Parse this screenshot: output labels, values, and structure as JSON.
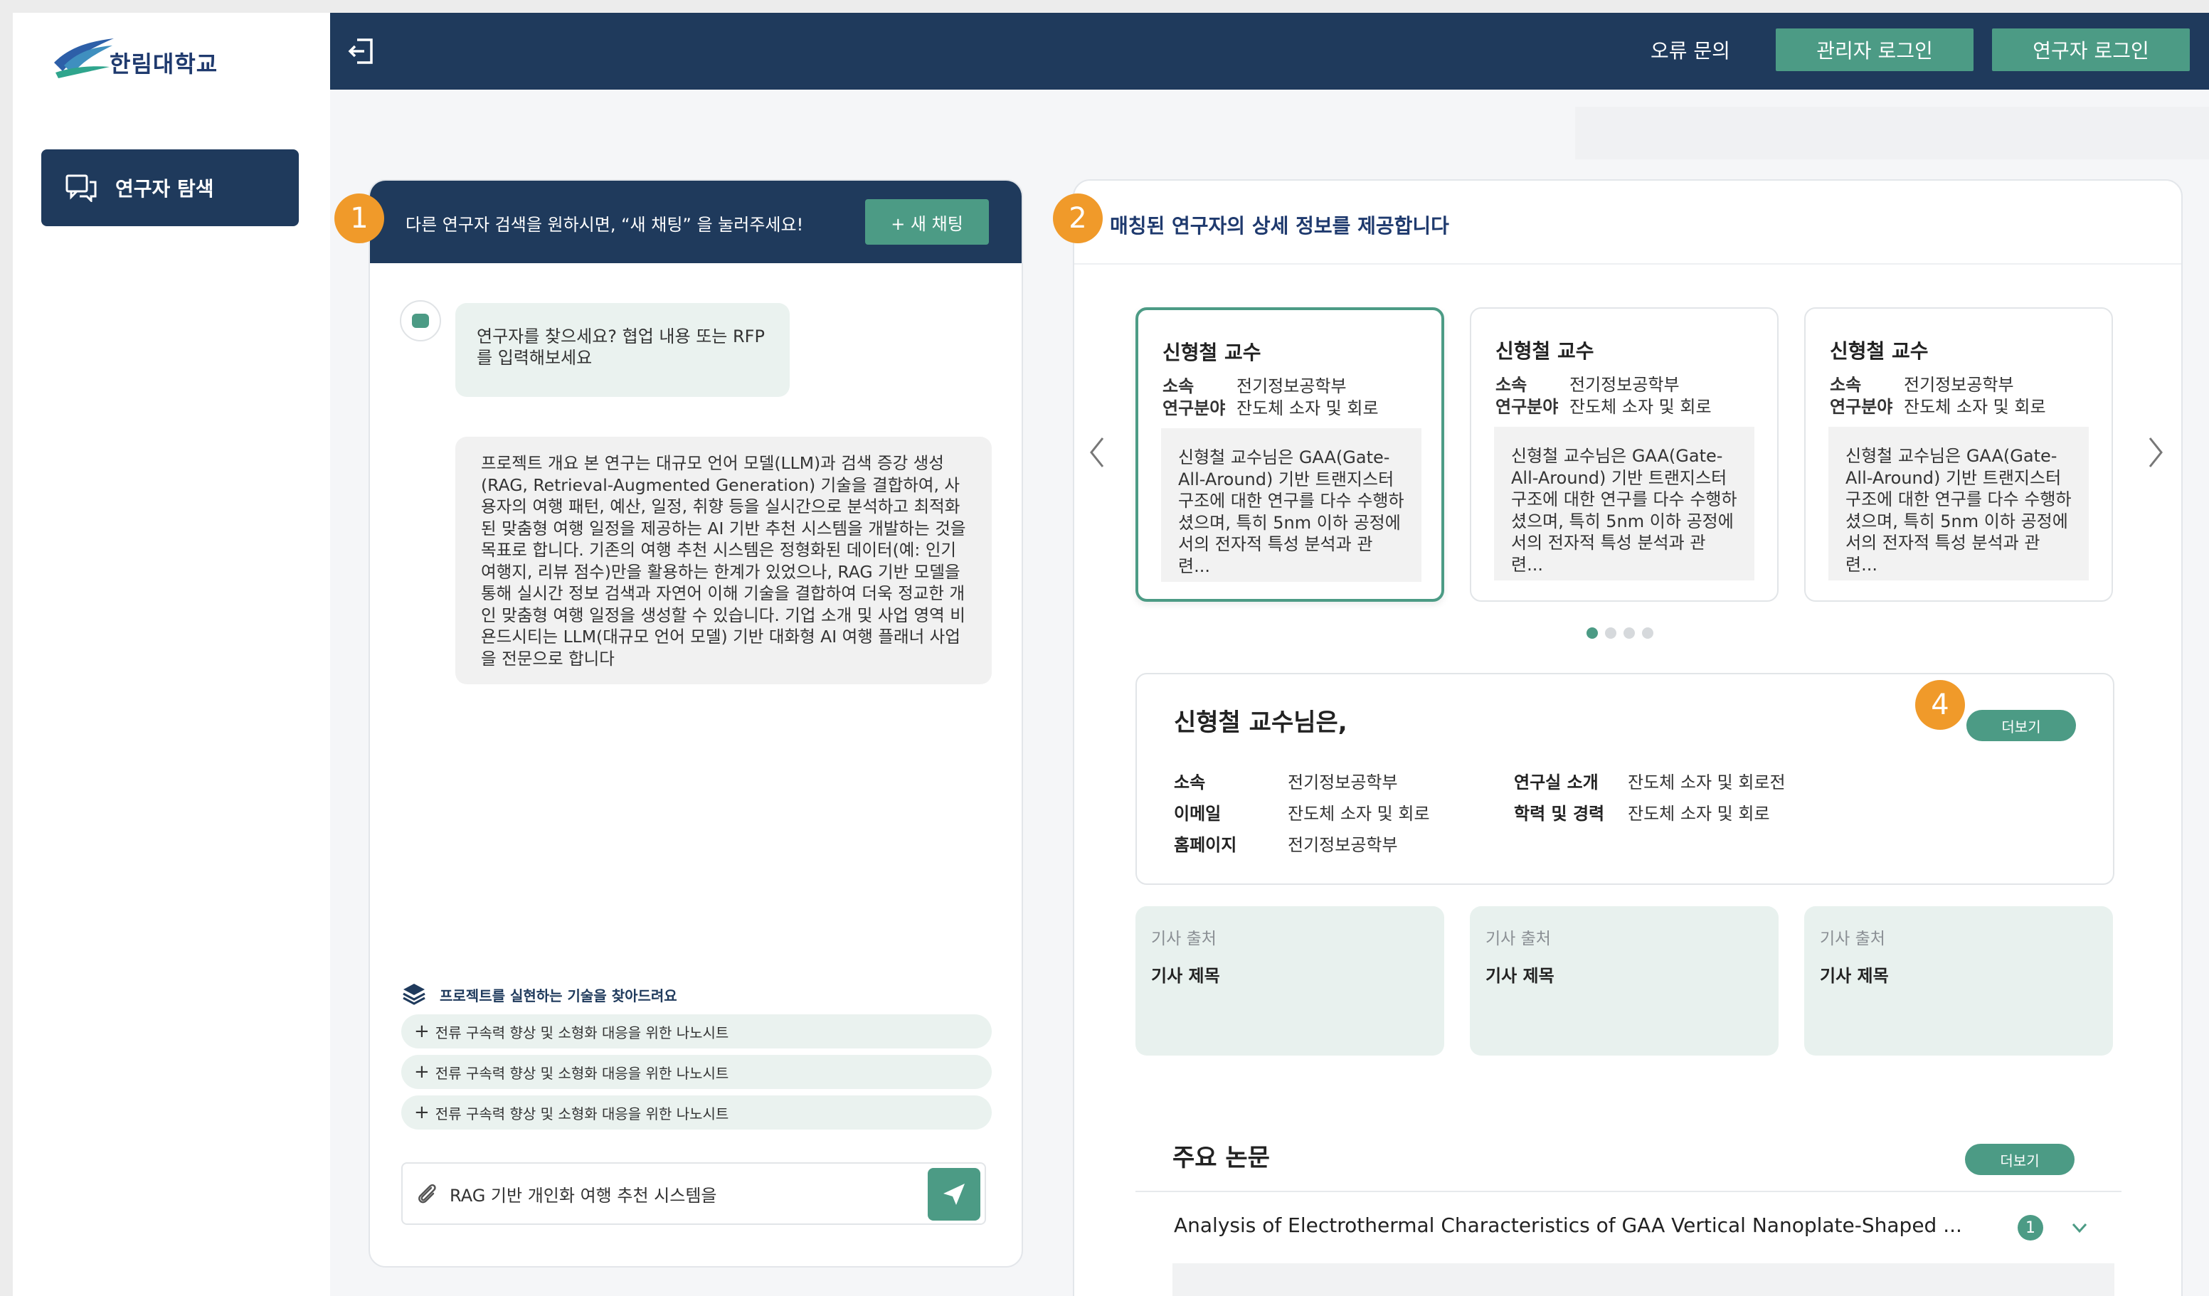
{
  "brand": {
    "name": "한림대학교"
  },
  "sidebar": {
    "items": [
      {
        "label": "연구자 탐색",
        "icon": "chat-icon"
      }
    ]
  },
  "header": {
    "error_link": "오류 문의",
    "admin_login": "관리자 로그인",
    "researcher_login": "연구자 로그인",
    "colors": {
      "navy": "#1f3a5c",
      "green": "#4c9b85",
      "badge": "#f09a2a"
    }
  },
  "chat": {
    "header_message": "다른 연구자 검색을 원하시면, “새 채팅” 을 눌러주세요!",
    "new_chat_label": "+ 새 채팅",
    "bot_message": "연구자를 찾으세요? 협업 내용 또는 RFP를 입력해보세요",
    "user_message": "프로젝트 개요 본 연구는 대규모 언어 모델(LLM)과 검색 증강 생성(RAG, Retrieval-Augmented Generation) 기술을 결합하여, 사용자의 여행 패턴, 예산, 일정, 취향 등을 실시간으로 분석하고 최적화된 맞춤형 여행 일정을 제공하는 AI 기반 추천 시스템을 개발하는 것을 목표로 합니다. 기존의 여행 추천 시스템은 정형화된 데이터(예: 인기 여행지, 리뷰 점수)만을 활용하는 한계가 있었으나, RAG 기반 모델을 통해 실시간 정보 검색과 자연어 이해 기술을 결합하여 더욱 정교한 개인 맞춤형 여행 일정을 생성할 수 있습니다. 기업 소개 및 사업 영역 비욘드시티는 LLM(대규모 언어 모델) 기반 대화형 AI 여행 플래너 사업을 전문으로 합니다",
    "tech_title": "프로젝트를 실현하는 기술을 찾아드려요",
    "tech_items": [
      "전류 구속력 향상 및 소형화 대응을 위한 나노시트",
      "전류 구속력 향상 및 소형화 대응을 위한 나노시트",
      "전류 구속력 향상 및 소형화 대응을 위한 나노시트"
    ],
    "input_value": "RAG 기반 개인화 여행 추천 시스템을",
    "badge": "1"
  },
  "detail": {
    "title": "매칭된 연구자의 상세 정보를 제공합니다",
    "badge": "2",
    "cards": [
      {
        "name": "신형철 교수",
        "affil_label": "소속",
        "affil": "전기정보공학부",
        "field_label": "연구분야",
        "field": "잔도체 소자 및 회로",
        "abstract": "신형철 교수님은 GAA(Gate-All-Around) 기반 트랜지스터 구조에 대한 연구를 다수 수행하셨으며, 특히 5nm 이하 공정에서의 전자적 특성 분석과 관련..."
      },
      {
        "name": "신형철 교수",
        "affil_label": "소속",
        "affil": "전기정보공학부",
        "field_label": "연구분야",
        "field": "잔도체 소자 및 회로",
        "abstract": "신형철 교수님은 GAA(Gate-All-Around) 기반 트랜지스터 구조에 대한 연구를 다수 수행하셨으며, 특히 5nm 이하 공정에서의 전자적 특성 분석과 관련..."
      },
      {
        "name": "신형철 교수",
        "affil_label": "소속",
        "affil": "전기정보공학부",
        "field_label": "연구분야",
        "field": "잔도체 소자 및 회로",
        "abstract": "신형철 교수님은 GAA(Gate-All-Around) 기반 트랜지스터 구조에 대한 연구를 다수 수행하셨으며, 특히 5nm 이하 공정에서의 전자적 특성 분석과 관련..."
      }
    ],
    "carousel_page": 1,
    "carousel_total": 4,
    "profile": {
      "title": "신형철 교수님은,",
      "more": "더보기",
      "badge": "4",
      "fields": {
        "affil_label": "소속",
        "affil": "전기정보공학부",
        "email_label": "이메일",
        "email": "잔도체 소자 및 회로",
        "homepage_label": "홈페이지",
        "homepage": "전기정보공학부",
        "lab_label": "연구실 소개",
        "lab": "잔도체 소자 및 회로전",
        "career_label": "학력 및 경력",
        "career": "잔도체 소자 및 회로"
      }
    },
    "articles": [
      {
        "source": "기사 출처",
        "title": "기사 제목"
      },
      {
        "source": "기사 출처",
        "title": "기사 제목"
      },
      {
        "source": "기사 출처",
        "title": "기사 제목"
      }
    ],
    "papers": {
      "title": "주요 논문",
      "more": "더보기",
      "items": [
        {
          "title": "Analysis of Electrothermal Characteristics of GAA Vertical Nanoplate-Shaped  ...",
          "count": "1"
        }
      ]
    }
  }
}
